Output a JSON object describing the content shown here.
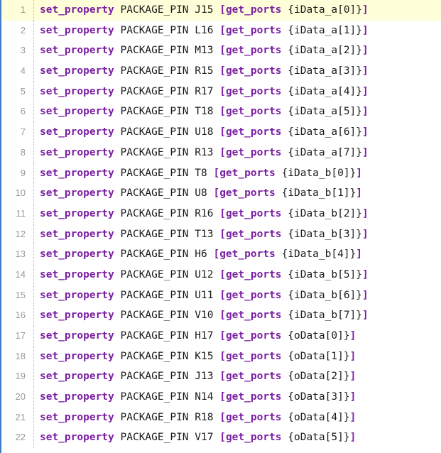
{
  "editor": {
    "current_line": 1,
    "lines": [
      {
        "num": "1",
        "cmd": "set_property",
        "arg": "PACKAGE_PIN",
        "pin": "J15",
        "fn": "get_ports",
        "port": "iData_a[0]"
      },
      {
        "num": "2",
        "cmd": "set_property",
        "arg": "PACKAGE_PIN",
        "pin": "L16",
        "fn": "get_ports",
        "port": "iData_a[1]"
      },
      {
        "num": "3",
        "cmd": "set_property",
        "arg": "PACKAGE_PIN",
        "pin": "M13",
        "fn": "get_ports",
        "port": "iData_a[2]"
      },
      {
        "num": "4",
        "cmd": "set_property",
        "arg": "PACKAGE_PIN",
        "pin": "R15",
        "fn": "get_ports",
        "port": "iData_a[3]"
      },
      {
        "num": "5",
        "cmd": "set_property",
        "arg": "PACKAGE_PIN",
        "pin": "R17",
        "fn": "get_ports",
        "port": "iData_a[4]"
      },
      {
        "num": "6",
        "cmd": "set_property",
        "arg": "PACKAGE_PIN",
        "pin": "T18",
        "fn": "get_ports",
        "port": "iData_a[5]"
      },
      {
        "num": "7",
        "cmd": "set_property",
        "arg": "PACKAGE_PIN",
        "pin": "U18",
        "fn": "get_ports",
        "port": "iData_a[6]"
      },
      {
        "num": "8",
        "cmd": "set_property",
        "arg": "PACKAGE_PIN",
        "pin": "R13",
        "fn": "get_ports",
        "port": "iData_a[7]"
      },
      {
        "num": "9",
        "cmd": "set_property",
        "arg": "PACKAGE_PIN",
        "pin": "T8",
        "fn": "get_ports",
        "port": "iData_b[0]"
      },
      {
        "num": "10",
        "cmd": "set_property",
        "arg": "PACKAGE_PIN",
        "pin": "U8",
        "fn": "get_ports",
        "port": "iData_b[1]"
      },
      {
        "num": "11",
        "cmd": "set_property",
        "arg": "PACKAGE_PIN",
        "pin": "R16",
        "fn": "get_ports",
        "port": "iData_b[2]"
      },
      {
        "num": "12",
        "cmd": "set_property",
        "arg": "PACKAGE_PIN",
        "pin": "T13",
        "fn": "get_ports",
        "port": "iData_b[3]"
      },
      {
        "num": "13",
        "cmd": "set_property",
        "arg": "PACKAGE_PIN",
        "pin": "H6",
        "fn": "get_ports",
        "port": "iData_b[4]"
      },
      {
        "num": "14",
        "cmd": "set_property",
        "arg": "PACKAGE_PIN",
        "pin": "U12",
        "fn": "get_ports",
        "port": "iData_b[5]"
      },
      {
        "num": "15",
        "cmd": "set_property",
        "arg": "PACKAGE_PIN",
        "pin": "U11",
        "fn": "get_ports",
        "port": "iData_b[6]"
      },
      {
        "num": "16",
        "cmd": "set_property",
        "arg": "PACKAGE_PIN",
        "pin": "V10",
        "fn": "get_ports",
        "port": "iData_b[7]"
      },
      {
        "num": "17",
        "cmd": "set_property",
        "arg": "PACKAGE_PIN",
        "pin": "H17",
        "fn": "get_ports",
        "port": "oData[0]"
      },
      {
        "num": "18",
        "cmd": "set_property",
        "arg": "PACKAGE_PIN",
        "pin": "K15",
        "fn": "get_ports",
        "port": "oData[1]"
      },
      {
        "num": "19",
        "cmd": "set_property",
        "arg": "PACKAGE_PIN",
        "pin": "J13",
        "fn": "get_ports",
        "port": "oData[2]"
      },
      {
        "num": "20",
        "cmd": "set_property",
        "arg": "PACKAGE_PIN",
        "pin": "N14",
        "fn": "get_ports",
        "port": "oData[3]"
      },
      {
        "num": "21",
        "cmd": "set_property",
        "arg": "PACKAGE_PIN",
        "pin": "R18",
        "fn": "get_ports",
        "port": "oData[4]"
      },
      {
        "num": "22",
        "cmd": "set_property",
        "arg": "PACKAGE_PIN",
        "pin": "V17",
        "fn": "get_ports",
        "port": "oData[5]"
      }
    ],
    "colors": {
      "keyword": "#7a1fa2",
      "current_line_bg": "#fefed9",
      "gutter_text": "#9a9a9a",
      "left_border": "#3e7cc8"
    }
  }
}
